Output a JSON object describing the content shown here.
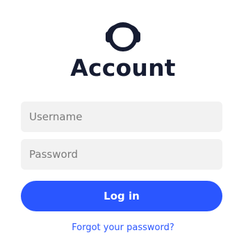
{
  "logo": {
    "icon": "headphones-head-icon",
    "color": "#161c32"
  },
  "title": "Account",
  "form": {
    "username_placeholder": "Username",
    "username_value": "",
    "password_placeholder": "Password",
    "password_value": "",
    "login_label": "Log in",
    "forgot_label": "Forgot your password?"
  },
  "colors": {
    "accent": "#2a56ff",
    "title": "#161c32",
    "field_bg": "#f2f2f2"
  }
}
